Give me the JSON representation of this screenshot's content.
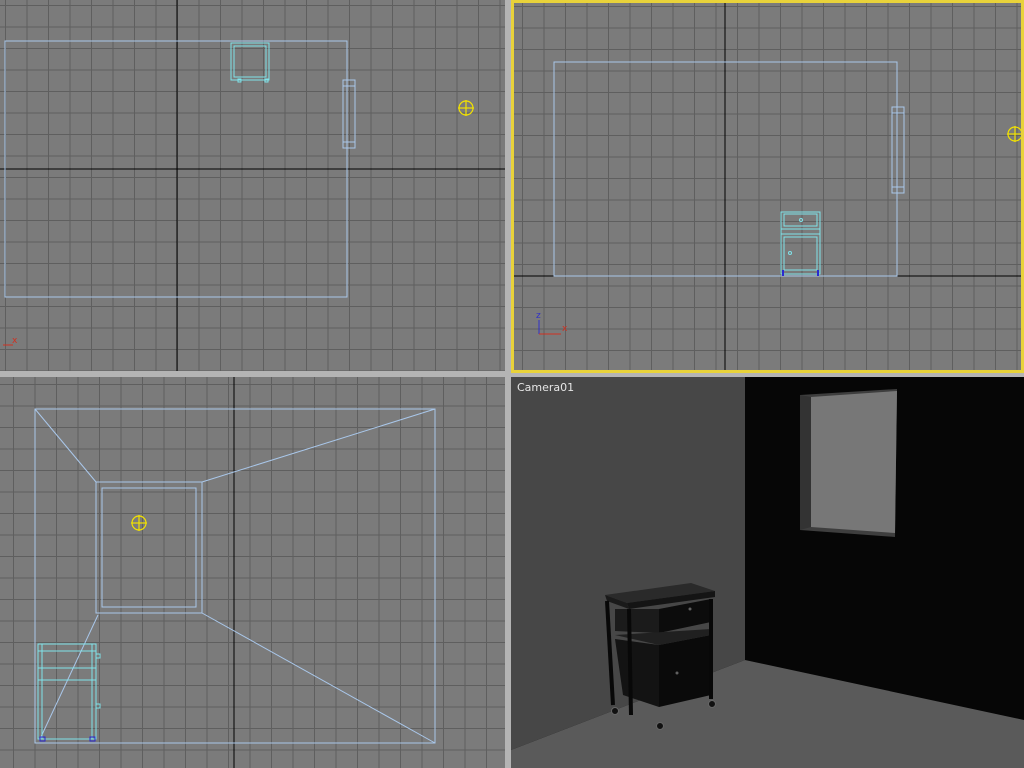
{
  "viewports": {
    "top": {
      "axis_x": "x"
    },
    "front": {
      "axis_x": "x",
      "axis_z": "z",
      "active": true
    },
    "left": {},
    "camera": {
      "label": "Camera01"
    }
  },
  "colors": {
    "grid_bg": "#7b7b7b",
    "grid_line": "#5f5f5f",
    "main_axis": "#000000",
    "wireframe": "#a9c7ea",
    "object_selected": "#7fe3ea",
    "light_icon": "#f2e200",
    "active_border": "#e8d23a"
  },
  "icons": [
    "light-icon",
    "axis-tripod-icon"
  ]
}
